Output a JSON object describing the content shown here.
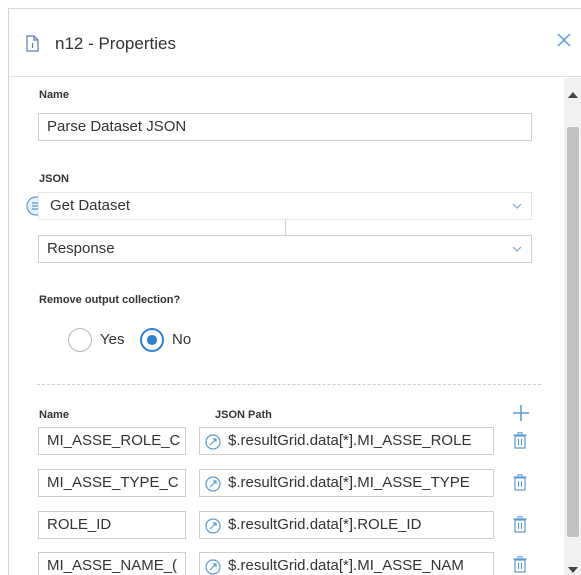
{
  "header": {
    "title": "n12 - Properties"
  },
  "name_section": {
    "label": "Name",
    "value": "Parse Dataset JSON"
  },
  "json_section": {
    "label": "JSON",
    "source_value": "Get Dataset",
    "property_value": "Response"
  },
  "remove_output": {
    "label": "Remove output collection?",
    "yes_label": "Yes",
    "no_label": "No",
    "selected": "No"
  },
  "mapping_table": {
    "name_header": "Name",
    "path_header": "JSON Path",
    "rows": [
      {
        "name": "MI_ASSE_ROLE_C",
        "path": "$.resultGrid.data[*].MI_ASSE_ROLE"
      },
      {
        "name": "MI_ASSE_TYPE_C",
        "path": "$.resultGrid.data[*].MI_ASSE_TYPE"
      },
      {
        "name": "ROLE_ID",
        "path": "$.resultGrid.data[*].ROLE_ID"
      },
      {
        "name": "MI_ASSE_NAME_(",
        "path": "$.resultGrid.data[*].MI_ASSE_NAM"
      }
    ]
  },
  "colors": {
    "accent": "#2e7fd6",
    "icon_blue": "#5b9bd5",
    "border": "#cfcfcf"
  }
}
